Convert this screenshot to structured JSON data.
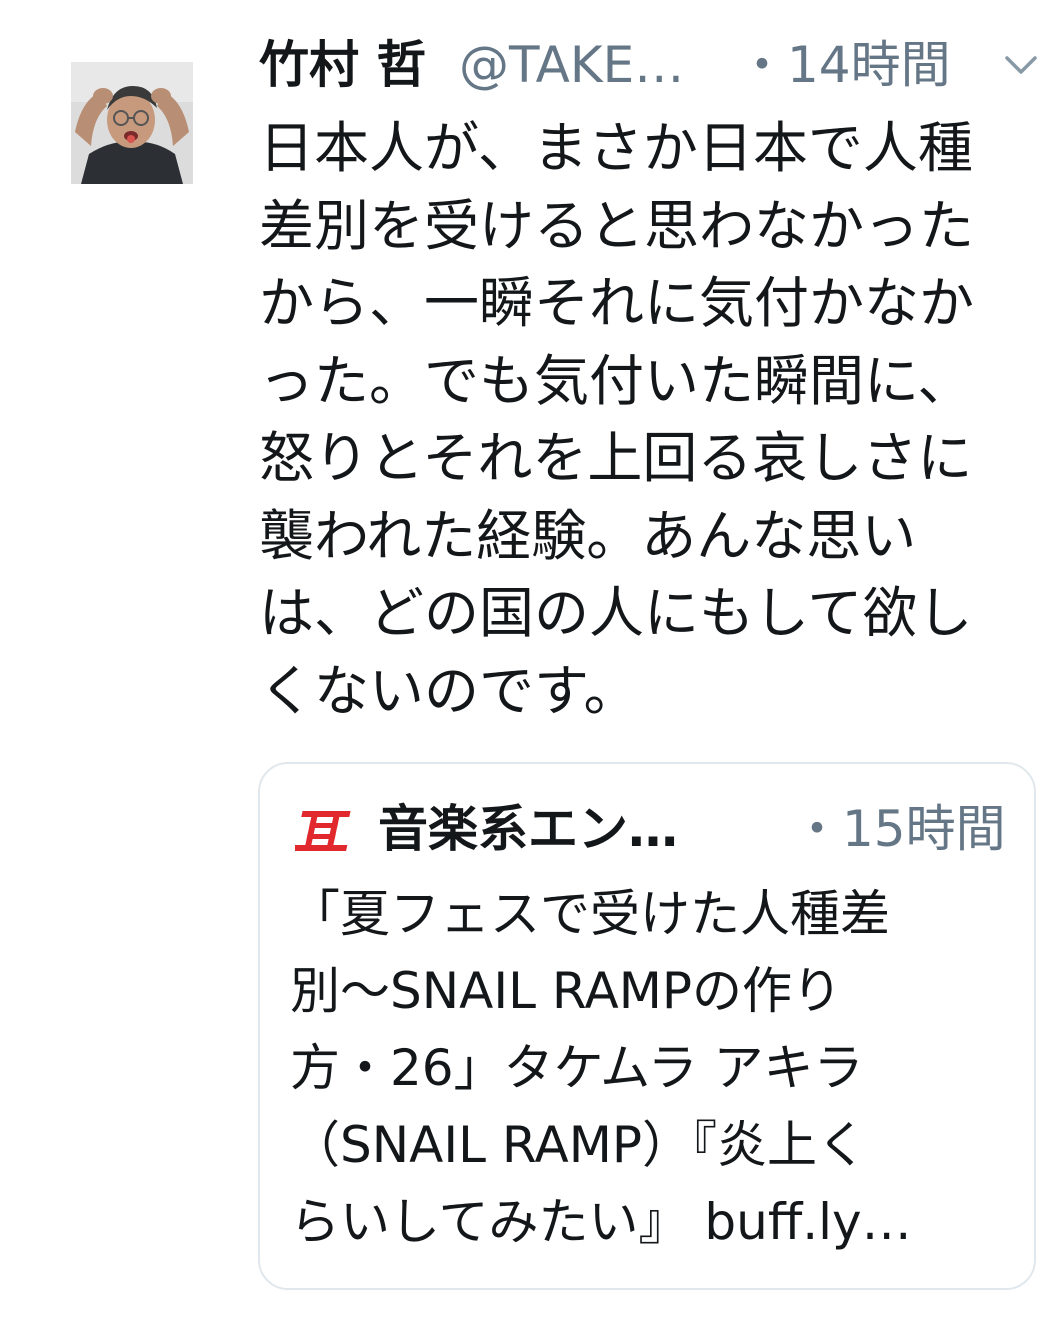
{
  "tweet": {
    "author_name": "竹村 哲",
    "author_handle": "@TAKE…",
    "timestamp": "・14時間",
    "avatar_icon": "profile-photo",
    "menu_icon": "chevron-down-icon",
    "text_lines": [
      "日本人が、まさか日本で人種",
      "差別を受けると思わなかった",
      "から、一瞬それに気付かなか",
      "った。でも気付いた瞬間に、",
      "怒りとそれを上回る哀しさに",
      "襲われた経験。あんな思い",
      "は、どの国の人にもして欲し",
      "くないのです。"
    ]
  },
  "quoted_tweet": {
    "logo_icon": "mimi-logo-icon",
    "author_name": "音楽系エン…",
    "timestamp": "・15時間",
    "text_lines": [
      "「夏フェスで受けた人種差",
      "別～SNAIL RAMPの作り",
      "方・26」タケムラ アキラ",
      "（SNAIL RAMP）『炎上く",
      "らいしてみたい』 buff.ly…"
    ]
  },
  "colors": {
    "text_primary": "#14171a",
    "text_secondary": "#657786",
    "card_border": "#e1e8ed",
    "logo_red": "#e0282d"
  }
}
